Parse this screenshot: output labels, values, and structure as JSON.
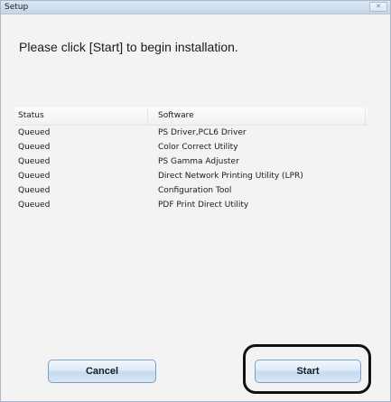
{
  "window": {
    "title": "Setup",
    "close_glyph": "✕"
  },
  "prompt": "Please click [Start] to begin installation.",
  "table": {
    "headers": {
      "status": "Status",
      "software": "Software"
    },
    "rows": [
      {
        "status": "Queued",
        "software": "PS Driver,PCL6 Driver"
      },
      {
        "status": "Queued",
        "software": "Color Correct Utility"
      },
      {
        "status": "Queued",
        "software": "PS Gamma Adjuster"
      },
      {
        "status": "Queued",
        "software": "Direct Network Printing Utility (LPR)"
      },
      {
        "status": "Queued",
        "software": "Configuration Tool"
      },
      {
        "status": "Queued",
        "software": "PDF Print Direct Utility"
      }
    ]
  },
  "buttons": {
    "cancel": "Cancel",
    "start": "Start"
  }
}
